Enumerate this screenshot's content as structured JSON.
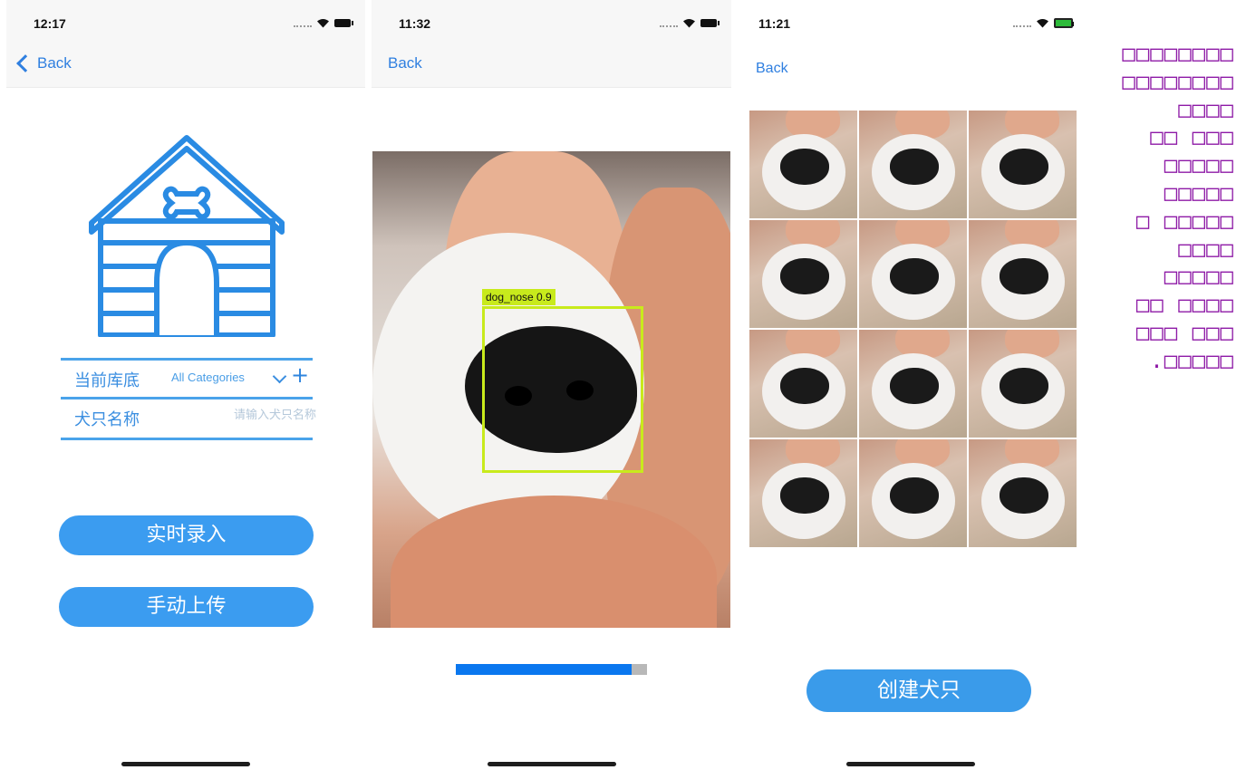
{
  "screen1": {
    "status_time": "12:17",
    "back_label": "Back",
    "fields": {
      "library_label": "当前库底",
      "library_value": "All Categories",
      "name_label": "犬只名称",
      "name_placeholder": "请输入犬只名称"
    },
    "buttons": {
      "live_entry": "实时录入",
      "manual_upload": "手动上传"
    },
    "icons": [
      "chevron-left-icon",
      "doghouse-icon",
      "bone-icon",
      "chevron-down-icon",
      "plus-icon",
      "wifi-icon",
      "battery-icon"
    ]
  },
  "screen2": {
    "status_time": "11:32",
    "back_label": "Back",
    "detection": {
      "label": "dog_nose 0.9",
      "class": "dog_nose",
      "score": 0.9,
      "box_color": "#c8ea1c"
    },
    "progress": 0.92
  },
  "screen3": {
    "status_time": "11:21",
    "back_label": "Back",
    "thumbnail_grid": {
      "rows": 4,
      "cols": 3,
      "count": 12
    },
    "create_button": "创建犬只"
  },
  "caption": "□□□□□□□□\n□□□□□□□□\n□□□□\n□□ □□□\n□□□□□\n□□□□□\n□ □□□□□\n□□□□\n□□□□□\n□□ □□□□\n□□□ □□□\n.□□□□□",
  "colors": {
    "accent": "#3b9cf0",
    "link": "#2f7fe0",
    "detection_box": "#c8ea1c",
    "progress_fill": "#0a77ef",
    "caption": "#8e1aa6"
  }
}
